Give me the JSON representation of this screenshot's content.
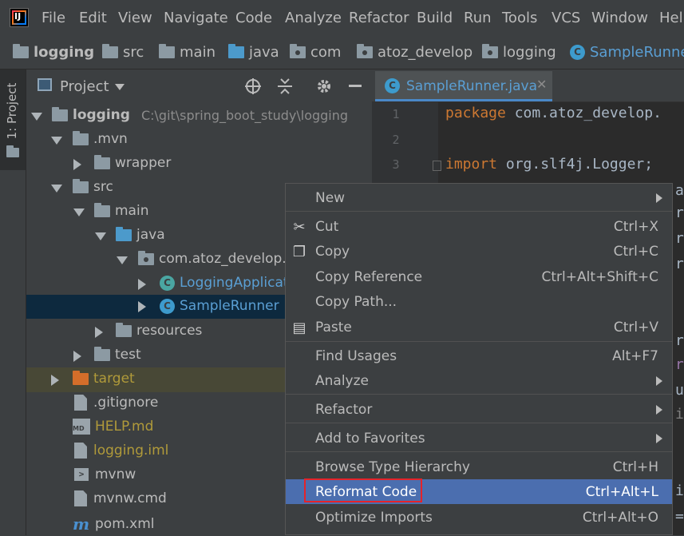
{
  "menubar": {
    "logo_text": "IJ",
    "items": [
      "File",
      "Edit",
      "View",
      "Navigate",
      "Code",
      "Analyze",
      "Refactor",
      "Build",
      "Run",
      "Tools",
      "VCS",
      "Window",
      "Help"
    ]
  },
  "breadcrumb": {
    "items": [
      "logging",
      "src",
      "main",
      "java",
      "com",
      "atoz_develop",
      "logging",
      "SampleRunner"
    ]
  },
  "sidebar_stripe": {
    "label": "1: Project"
  },
  "project_panel": {
    "title": "Project",
    "tree": [
      {
        "label": "logging",
        "detail": "C:\\git\\spring_boot_study\\logging"
      },
      {
        "label": ".mvn"
      },
      {
        "label": "wrapper"
      },
      {
        "label": "src"
      },
      {
        "label": "main"
      },
      {
        "label": "java"
      },
      {
        "label": "com.atoz_develop.l"
      },
      {
        "label": "LoggingApplicat"
      },
      {
        "label": "SampleRunner"
      },
      {
        "label": "resources"
      },
      {
        "label": "test"
      },
      {
        "label": "target"
      },
      {
        "label": ".gitignore"
      },
      {
        "label": "HELP.md"
      },
      {
        "label": "logging.iml"
      },
      {
        "label": "mvnw"
      },
      {
        "label": "mvnw.cmd"
      },
      {
        "label": "pom.xml"
      }
    ]
  },
  "editor": {
    "tab_title": "SampleRunner.java",
    "line_numbers": [
      "1",
      "2",
      "3"
    ],
    "line1_kw": "package",
    "line1_rest": " com.atoz_develop.",
    "line3_kw": "import",
    "line3_rest": " org.slf4j.Logger;"
  },
  "context_menu": {
    "items": [
      {
        "label": "New",
        "shortcut": ""
      },
      {
        "label": "Cut",
        "shortcut": "Ctrl+X",
        "icon": "scissors-icon"
      },
      {
        "label": "Copy",
        "shortcut": "Ctrl+C",
        "icon": "copy-icon"
      },
      {
        "label": "Copy Reference",
        "shortcut": "Ctrl+Alt+Shift+C"
      },
      {
        "label": "Copy Path...",
        "shortcut": ""
      },
      {
        "label": "Paste",
        "shortcut": "Ctrl+V",
        "icon": "clipboard-icon"
      },
      {
        "label": "Find Usages",
        "shortcut": "Alt+F7"
      },
      {
        "label": "Analyze",
        "shortcut": ""
      },
      {
        "label": "Refactor",
        "shortcut": ""
      },
      {
        "label": "Add to Favorites",
        "shortcut": ""
      },
      {
        "label": "Browse Type Hierarchy",
        "shortcut": "Ctrl+H"
      },
      {
        "label": "Reformat Code",
        "shortcut": "Ctrl+Alt+L"
      },
      {
        "label": "Optimize Imports",
        "shortcut": "Ctrl+Alt+O"
      }
    ]
  },
  "colors": {
    "highlight": "#4b6eaf",
    "selection": "#0d293e",
    "annotation_box": "#e5232a"
  }
}
